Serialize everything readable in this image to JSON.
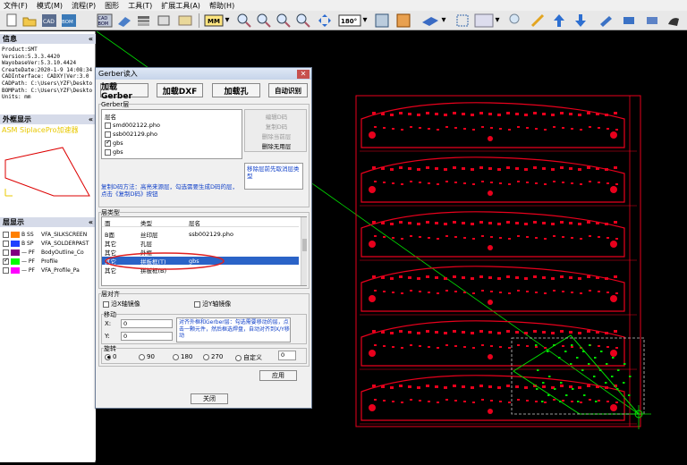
{
  "menu": [
    "文件(F)",
    "模式(M)",
    "流程(P)",
    "图形",
    "工具(T)",
    "扩展工具(A)",
    "帮助(H)"
  ],
  "toolbar": {
    "unit_label": "MM",
    "rotate_label": "180°",
    "badge_cad": "CAD",
    "badge_bom": "BOM"
  },
  "info_panel": {
    "title": "信息",
    "lines": [
      "Product:SMT",
      "Version:5.3.3.4420",
      "WayobaseVer:5.3.10.4424",
      "CreateDate:2020-1-9 14:08:34",
      "CADInterface: CADXY(Ver:3.0",
      "CADPath: C:\\Users\\YZF\\Deskto",
      "BOMPath: C:\\Users\\YZF\\Deskto",
      "Units: mm"
    ]
  },
  "outline_panel": {
    "title": "外框显示",
    "watermark": "ASM SiplacePro加速器"
  },
  "layer_panel": {
    "title": "层显示",
    "layers": [
      {
        "code": "B  SS",
        "name": "VFA_SILKSCREEN",
        "color": "#ff8000",
        "checked": false
      },
      {
        "code": "B  SP",
        "name": "VFA_SOLDERPAST",
        "color": "#2040ff",
        "checked": false
      },
      {
        "code": "— PF",
        "name": "BodyOutline_Co",
        "color": "#800080",
        "checked": false
      },
      {
        "code": "— PF",
        "name": "Profile",
        "color": "#00ff00",
        "checked": true
      },
      {
        "code": "— PF",
        "name": "VFA_Profile_Pa",
        "color": "#ff00ff",
        "checked": false
      }
    ]
  },
  "dialog": {
    "title": "Gerber读入",
    "buttons": {
      "load_gerber": "加载Gerber",
      "load_dxf": "加载DXF",
      "load_hole": "加载孔",
      "auto_identify": "自动识别",
      "close": "关闭",
      "apply": "应用"
    },
    "gerber_group": "Gerber层",
    "layer_name_header": "层名",
    "gerber_files": [
      {
        "name": "smd002122.pho",
        "checked": false
      },
      {
        "name": "ssb002129.pho",
        "checked": false
      },
      {
        "name": "gbs",
        "checked": true
      },
      {
        "name": "gbs",
        "checked": false
      }
    ],
    "side_actions": [
      "编辑D码",
      "复制D码",
      "删除当前层",
      "删除无用层"
    ],
    "side_note": "移除层前先取消层类型",
    "hint_text": "复制D码方法：高亮来源层，勾选需要生成D码的层，点击《复制D码》按钮",
    "layer_type_group": "层类型",
    "type_headers": [
      "面",
      "类型",
      "层名"
    ],
    "type_rows": [
      {
        "side": "B面",
        "type": "丝印层",
        "layer": "ssb002129.pho"
      },
      {
        "side": "其它",
        "type": "孔层",
        "layer": ""
      },
      {
        "side": "其它",
        "type": "外框",
        "layer": ""
      },
      {
        "side": "其它",
        "type": "拼板框(T)",
        "layer": "gbs"
      },
      {
        "side": "其它",
        "type": "拼板框(B)",
        "layer": ""
      }
    ],
    "align_group": "层对齐",
    "mirror_x": "沿X轴镜像",
    "mirror_y": "沿Y轴镜像",
    "move_group": "移动",
    "x_label": "X:",
    "y_label": "Y:",
    "x_value": "0",
    "y_value": "0",
    "move_hint": "对齐外框和Gerber层：勾选需要移动的层，点击一颗元件，然后框选焊盘，自动对齐到X/Y移动",
    "rotate_group": "旋转",
    "rotate_options": [
      "0",
      "90",
      "180",
      "270",
      "自定义"
    ],
    "rotate_selected": "0",
    "custom_value": "0"
  },
  "colors": {
    "pcb_red": "#e8001c",
    "profile_green": "#00e000",
    "highlight_blue": "#2a63c7"
  }
}
